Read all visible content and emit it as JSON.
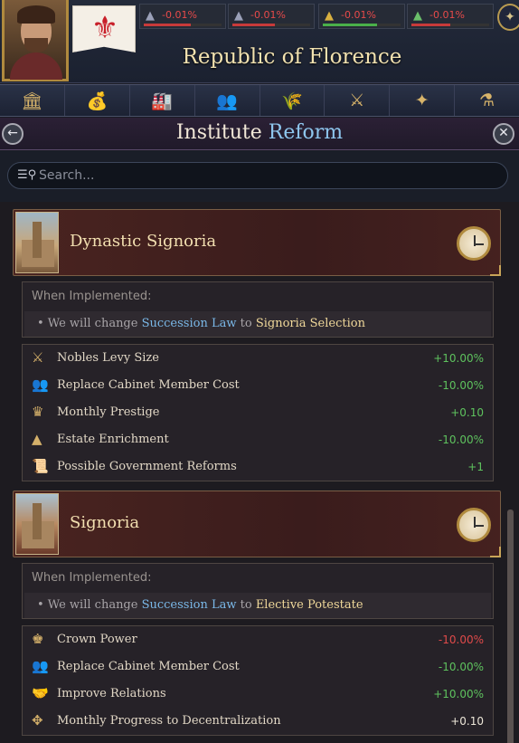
{
  "header": {
    "country_name": "Republic of Florence",
    "stats": [
      {
        "icon": "crown-estate-icon",
        "value": "-0.01%",
        "bar_color": "#c83a3a",
        "bar_fill": 0.6
      },
      {
        "icon": "clergy-estate-icon",
        "value": "-0.01%",
        "bar_color": "#c83a3a",
        "bar_fill": 0.55
      },
      {
        "icon": "burgher-estate-icon",
        "value": "-0.01%",
        "bar_color": "#4ab04a",
        "bar_fill": 0.7
      },
      {
        "icon": "peasant-estate-icon",
        "value": "-0.01%",
        "bar_color": "#c83a3a",
        "bar_fill": 0.5
      }
    ]
  },
  "tabs": [
    {
      "name": "government-icon",
      "glyph": "🏛"
    },
    {
      "name": "economy-icon",
      "glyph": "💰"
    },
    {
      "name": "production-icon",
      "glyph": "🏭"
    },
    {
      "name": "diplomacy-icon",
      "glyph": "👥"
    },
    {
      "name": "agriculture-icon",
      "glyph": "🌾"
    },
    {
      "name": "military-icon",
      "glyph": "⚔"
    },
    {
      "name": "exploration-icon",
      "glyph": "✦"
    },
    {
      "name": "alchemy-icon",
      "glyph": "⚗"
    }
  ],
  "panel": {
    "title_part1": "Institute",
    "title_part2": "Reform"
  },
  "search": {
    "placeholder": "Search..."
  },
  "reforms": [
    {
      "name": "Dynastic Signoria",
      "when_label": "When Implemented:",
      "change_prefix": "• We will change ",
      "change_law": "Succession Law",
      "change_mid": " to ",
      "change_target": "Signoria Selection",
      "effects": [
        {
          "icon": "nobles-levy-icon",
          "glyph": "⚔",
          "label": "Nobles Levy Size",
          "value": "+10.00%",
          "tone": "pos"
        },
        {
          "icon": "cabinet-cost-icon",
          "glyph": "👥",
          "label": "Replace Cabinet Member Cost",
          "value": "-10.00%",
          "tone": "pos"
        },
        {
          "icon": "prestige-icon",
          "glyph": "♛",
          "label": "Monthly Prestige",
          "value": "+0.10",
          "tone": "pos"
        },
        {
          "icon": "estate-enrichment-icon",
          "glyph": "▲",
          "label": "Estate Enrichment",
          "value": "-10.00%",
          "tone": "pos"
        },
        {
          "icon": "reforms-icon",
          "glyph": "📜",
          "label": "Possible Government Reforms",
          "value": "+1",
          "tone": "pos"
        }
      ]
    },
    {
      "name": "Signoria",
      "when_label": "When Implemented:",
      "change_prefix": "• We will change ",
      "change_law": "Succession Law",
      "change_mid": " to ",
      "change_target": "Elective Potestate",
      "effects": [
        {
          "icon": "crown-power-icon",
          "glyph": "♚",
          "label": "Crown Power",
          "value": "-10.00%",
          "tone": "neg"
        },
        {
          "icon": "cabinet-cost-icon",
          "glyph": "👥",
          "label": "Replace Cabinet Member Cost",
          "value": "-10.00%",
          "tone": "pos"
        },
        {
          "icon": "improve-relations-icon",
          "glyph": "🤝",
          "label": "Improve Relations",
          "value": "+10.00%",
          "tone": "pos"
        },
        {
          "icon": "decentralization-icon",
          "glyph": "✥",
          "label": "Monthly Progress to Decentralization",
          "value": "+0.10",
          "tone": "neu"
        }
      ]
    }
  ]
}
